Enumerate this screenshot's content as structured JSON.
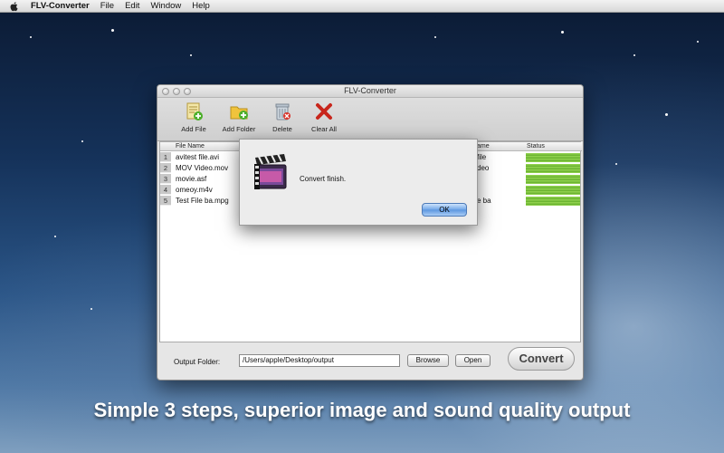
{
  "menubar": {
    "app_name": "FLV-Converter",
    "items": [
      "File",
      "Edit",
      "Window",
      "Help"
    ]
  },
  "window": {
    "title": "FLV-Converter",
    "toolbar": {
      "add_file": "Add File",
      "add_folder": "Add Folder",
      "delete": "Delete",
      "clear_all": "Clear All"
    },
    "table": {
      "columns": {
        "file_name": "File Name",
        "target_name_visible": "ame",
        "status": "Status"
      },
      "rows": [
        {
          "index": "1",
          "file_name": "avitest file.avi",
          "target_visible": "file",
          "status_progress": 1.0
        },
        {
          "index": "2",
          "file_name": "MOV Video.mov",
          "target_visible": "deo",
          "status_progress": 1.0
        },
        {
          "index": "3",
          "file_name": "movie.asf",
          "target_visible": "",
          "status_progress": 1.0
        },
        {
          "index": "4",
          "file_name": "omeoy.m4v",
          "target_visible": "",
          "status_progress": 1.0
        },
        {
          "index": "5",
          "file_name": "Test File ba.mpg",
          "target_visible": "e ba",
          "status_progress": 1.0
        }
      ]
    },
    "output": {
      "label": "Output Folder:",
      "path": "/Users/apple/Desktop/output",
      "browse": "Browse",
      "open": "Open",
      "convert": "Convert"
    }
  },
  "dialog": {
    "message": "Convert finish.",
    "ok": "OK",
    "icon": "film-clapper-icon"
  },
  "caption": "Simple 3 steps, superior image and sound quality output",
  "colors": {
    "status_green": "#7ec545",
    "ok_button_blue": "#5b95df"
  }
}
